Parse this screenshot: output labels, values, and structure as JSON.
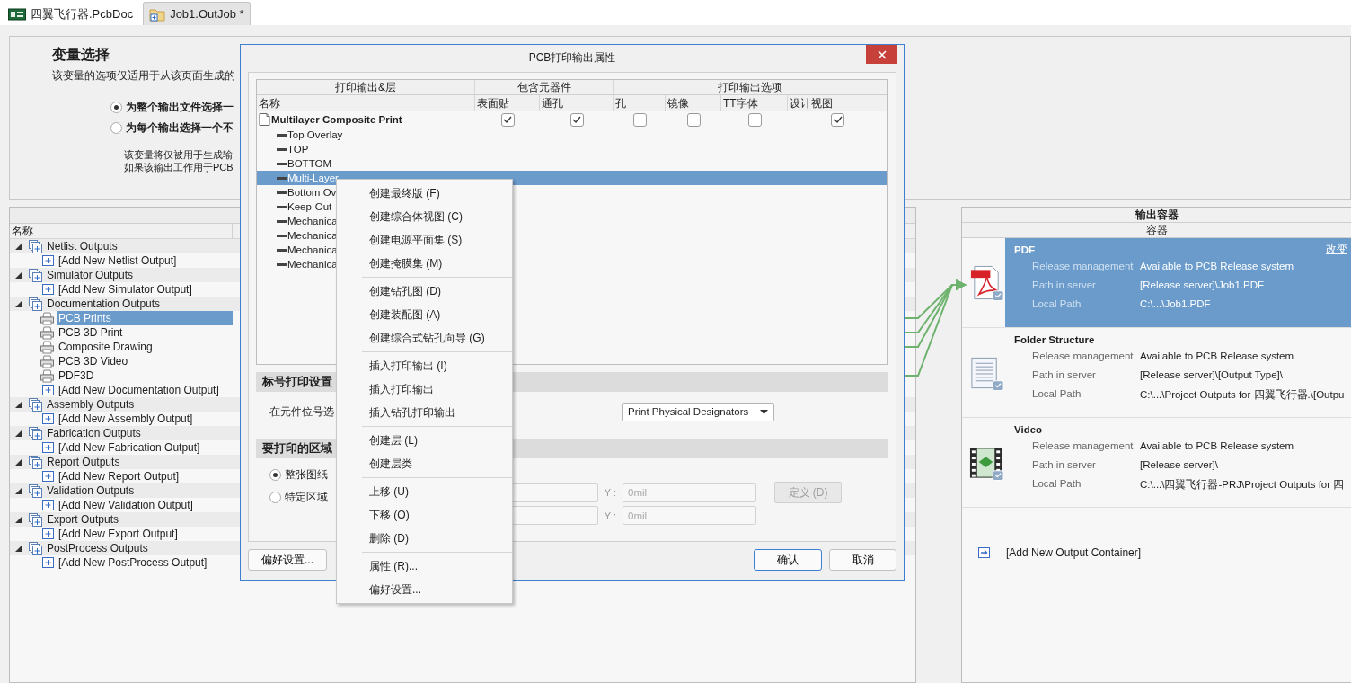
{
  "tabs": [
    {
      "label": "四翼飞行器.PcbDoc",
      "selected": false,
      "kind": "pcb"
    },
    {
      "label": "Job1.OutJob *",
      "selected": true,
      "kind": "outjob"
    }
  ],
  "variant": {
    "title": "变量选择",
    "description": "该变量的选项仅适用于从该页面生成的",
    "options": [
      {
        "label": "为整个输出文件选择一",
        "selected": true
      },
      {
        "label": "为每个输出选择一个不",
        "selected": false
      }
    ],
    "notes": [
      "该变量将仅被用于生成输",
      "如果该输出工作用于PCB"
    ]
  },
  "outputs": {
    "columns": [
      "名称"
    ],
    "groups": [
      {
        "name": "Netlist Outputs",
        "expanded": true,
        "items": [
          {
            "kind": "add",
            "name": "[Add New Netlist Output]"
          }
        ]
      },
      {
        "name": "Simulator Outputs",
        "expanded": true,
        "items": [
          {
            "kind": "add",
            "name": "[Add New Simulator Output]"
          }
        ]
      },
      {
        "name": "Documentation Outputs",
        "expanded": true,
        "items": [
          {
            "kind": "output",
            "name": "PCB Prints",
            "selected": true,
            "connected": true
          },
          {
            "kind": "output",
            "name": "PCB 3D Print",
            "selected": false,
            "connected": true
          },
          {
            "kind": "output",
            "name": "Composite Drawing",
            "selected": false,
            "connected": true
          },
          {
            "kind": "output",
            "name": "PCB 3D Video",
            "selected": false,
            "connected": false
          },
          {
            "kind": "output",
            "name": "PDF3D",
            "selected": false,
            "connected": true
          },
          {
            "kind": "add",
            "name": "[Add New Documentation Output]"
          }
        ]
      },
      {
        "name": "Assembly Outputs",
        "expanded": true,
        "items": [
          {
            "kind": "add",
            "name": "[Add New Assembly Output]"
          }
        ]
      },
      {
        "name": "Fabrication Outputs",
        "expanded": true,
        "items": [
          {
            "kind": "add",
            "name": "[Add New Fabrication Output]"
          }
        ]
      },
      {
        "name": "Report Outputs",
        "expanded": true,
        "items": [
          {
            "kind": "add",
            "name": "[Add New Report Output]"
          }
        ]
      },
      {
        "name": "Validation Outputs",
        "expanded": true,
        "items": [
          {
            "kind": "add",
            "name": "[Add New Validation Output]"
          }
        ]
      },
      {
        "name": "Export Outputs",
        "expanded": true,
        "items": [
          {
            "kind": "add",
            "name": "[Add New Export Output]"
          }
        ]
      },
      {
        "name": "PostProcess Outputs",
        "expanded": true,
        "items": [
          {
            "kind": "add",
            "name": "[Add New PostProcess Output]"
          }
        ]
      }
    ]
  },
  "containers_panel": {
    "title": "输出容器",
    "column": "容器",
    "change_link": "改变",
    "containers": [
      {
        "kind": "pdf",
        "name": "PDF",
        "selected": true,
        "props": [
          {
            "label": "Release management",
            "value": "Available to PCB Release system"
          },
          {
            "label": "Path in server",
            "value": "[Release server]\\Job1.PDF"
          },
          {
            "label": "Local Path",
            "value": "C:\\...\\Job1.PDF"
          }
        ]
      },
      {
        "kind": "folder",
        "name": "Folder Structure",
        "selected": false,
        "props": [
          {
            "label": "Release management",
            "value": "Available to PCB Release system"
          },
          {
            "label": "Path in server",
            "value": "[Release server]\\[Output Type]\\"
          },
          {
            "label": "Local Path",
            "value": "C:\\...\\Project Outputs for 四翼飞行器.\\[Outpu"
          }
        ]
      },
      {
        "kind": "video",
        "name": "Video",
        "selected": false,
        "props": [
          {
            "label": "Release management",
            "value": "Available to PCB Release system"
          },
          {
            "label": "Path in server",
            "value": "[Release server]\\"
          },
          {
            "label": "Local Path",
            "value": "C:\\...\\四翼飞行器-PRJ\\Project Outputs for 四"
          }
        ]
      }
    ],
    "add_container": "[Add New Output Container]"
  },
  "dialog": {
    "title": "PCB打印输出属性",
    "header_groups": [
      {
        "label": "打印输出&层",
        "columns": [
          "名称"
        ]
      },
      {
        "label": "包含元器件",
        "columns": [
          "表面贴",
          "通孔"
        ]
      },
      {
        "label": "打印输出选项",
        "columns": [
          "孔",
          "镜像",
          "TT字体",
          "设计视图"
        ]
      }
    ],
    "printouts": [
      {
        "name": "Multilayer Composite Print",
        "options": [
          true,
          true,
          false,
          false,
          false,
          true
        ],
        "layers": [
          {
            "name": "Top Overlay",
            "selected": false
          },
          {
            "name": "TOP",
            "selected": false
          },
          {
            "name": "BOTTOM",
            "selected": false
          },
          {
            "name": "Multi-Layer",
            "selected": true
          },
          {
            "name": "Bottom Ov",
            "selected": false
          },
          {
            "name": "Keep-Out",
            "selected": false
          },
          {
            "name": "Mechanica",
            "selected": false
          },
          {
            "name": "Mechanica",
            "selected": false
          },
          {
            "name": "Mechanica",
            "selected": false
          },
          {
            "name": "Mechanica",
            "selected": false
          }
        ]
      }
    ],
    "designator_section": {
      "title": "标号打印设置",
      "label": "在元件位号选",
      "select_value": "Print Physical Designators"
    },
    "area_section": {
      "title": "要打印的区域",
      "options": [
        {
          "label": "整张图纸",
          "selected": true
        },
        {
          "label": "特定区域",
          "selected": false
        }
      ],
      "coords": [
        {
          "y_label": "Y :",
          "y_placeholder": "0mil"
        },
        {
          "y_label": "Y :",
          "y_placeholder": "0mil"
        }
      ],
      "define_button": {
        "label": "定义 (D)",
        "disabled": true
      }
    },
    "preferences_button": "偏好设置...",
    "ok_button": "确认",
    "cancel_button": "取消"
  },
  "context_menu": {
    "groups": [
      [
        "创建最终版 (F)",
        "创建综合体视图 (C)",
        "创建电源平面集 (S)",
        "创建掩膜集 (M)"
      ],
      [
        "创建钻孔图 (D)",
        "创建装配图 (A)",
        "创建综合式钻孔向导 (G)"
      ],
      [
        "插入打印输出 (I)",
        "插入打印输出",
        "插入钻孔打印输出"
      ],
      [
        "创建层 (L)",
        "创建层类"
      ],
      [
        "上移 (U)",
        "下移 (O)",
        "删除 (D)"
      ],
      [
        "属性 (R)...",
        "偏好设置..."
      ]
    ]
  }
}
